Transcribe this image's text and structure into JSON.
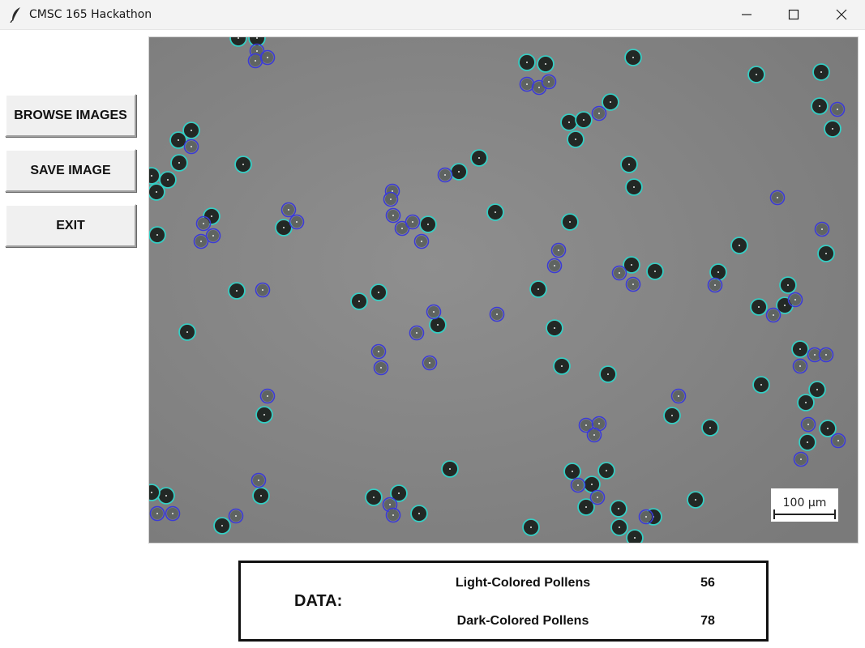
{
  "window": {
    "title": "CMSC 165 Hackathon",
    "icons": [
      "feather-icon",
      "minimize-icon",
      "maximize-icon",
      "close-icon"
    ]
  },
  "sidebar": {
    "browse_label": "BROWSE IMAGES",
    "save_label": "SAVE IMAGE",
    "exit_label": "EXIT"
  },
  "image": {
    "description": "Microscope image of pollen grains with detection circles",
    "scale_bar_label": "100 µm",
    "colors": {
      "background": "#8a8a8a",
      "pollen": "#222825",
      "light_detection": "#2ed3c8",
      "dark_detection": "#3b3bd6"
    }
  },
  "data_panel": {
    "label": "DATA:",
    "rows": [
      {
        "name": "Light-Colored Pollens",
        "value": "56"
      },
      {
        "name": "Dark-Colored Pollens",
        "value": "78"
      }
    ]
  }
}
